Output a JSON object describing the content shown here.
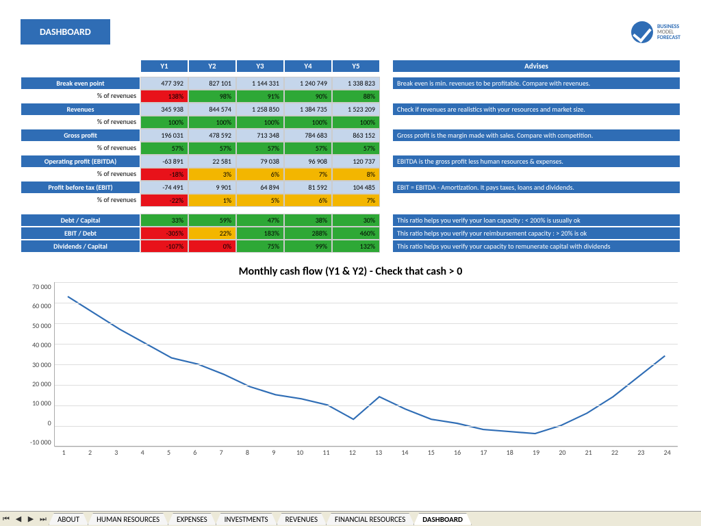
{
  "title": "DASHBOARD",
  "logo": {
    "l1": "BUSINESS",
    "l2": "MODEL",
    "l3": "FORECAST"
  },
  "years": [
    "Y1",
    "Y2",
    "Y3",
    "Y4",
    "Y5"
  ],
  "advises_header": "Advises",
  "rows": [
    {
      "label": "Break even point",
      "vals": [
        "477 392",
        "827 101",
        "1 144 331",
        "1 240 749",
        "1 338 823"
      ],
      "advice": "Break even is min. revenues to be profitable. Compare with revenues."
    },
    {
      "sub": "% of revenues",
      "pct": [
        {
          "v": "138%",
          "c": "red"
        },
        {
          "v": "98%",
          "c": "green"
        },
        {
          "v": "91%",
          "c": "green"
        },
        {
          "v": "90%",
          "c": "green"
        },
        {
          "v": "88%",
          "c": "green"
        }
      ]
    },
    {
      "label": "Revenues",
      "vals": [
        "345 938",
        "844 574",
        "1 258 850",
        "1 384 735",
        "1 523 209"
      ],
      "advice": "Check if revenues are realistics with your resources and market size."
    },
    {
      "sub": "% of revenues",
      "pct": [
        {
          "v": "100%",
          "c": "green"
        },
        {
          "v": "100%",
          "c": "green"
        },
        {
          "v": "100%",
          "c": "green"
        },
        {
          "v": "100%",
          "c": "green"
        },
        {
          "v": "100%",
          "c": "green"
        }
      ]
    },
    {
      "label": "Gross profit",
      "vals": [
        "196 031",
        "478 592",
        "713 348",
        "784 683",
        "863 152"
      ],
      "advice": "Gross profit is the margin made with sales. Compare with competition."
    },
    {
      "sub": "% of revenues",
      "pct": [
        {
          "v": "57%",
          "c": "green"
        },
        {
          "v": "57%",
          "c": "green"
        },
        {
          "v": "57%",
          "c": "green"
        },
        {
          "v": "57%",
          "c": "green"
        },
        {
          "v": "57%",
          "c": "green"
        }
      ]
    },
    {
      "label": "Operating profit (EBITDA)",
      "vals": [
        "-63 891",
        "22 581",
        "79 038",
        "96 908",
        "120 737"
      ],
      "advice": "EBITDA is the gross profit less human resources & expenses."
    },
    {
      "sub": "% of revenues",
      "pct": [
        {
          "v": "-18%",
          "c": "red"
        },
        {
          "v": "3%",
          "c": "amber"
        },
        {
          "v": "6%",
          "c": "amber"
        },
        {
          "v": "7%",
          "c": "amber"
        },
        {
          "v": "8%",
          "c": "amber"
        }
      ]
    },
    {
      "label": "Profit before tax (EBIT)",
      "vals": [
        "-74 491",
        "9 901",
        "64 894",
        "81 592",
        "104 485"
      ],
      "advice": "EBIT = EBITDA - Amortization. It pays taxes, loans and dividends."
    },
    {
      "sub": "% of revenues",
      "pct": [
        {
          "v": "-22%",
          "c": "red"
        },
        {
          "v": "1%",
          "c": "amber"
        },
        {
          "v": "5%",
          "c": "amber"
        },
        {
          "v": "6%",
          "c": "amber"
        },
        {
          "v": "7%",
          "c": "amber"
        }
      ]
    }
  ],
  "ratio_rows": [
    {
      "label": "Debt / Capital",
      "pct": [
        {
          "v": "33%",
          "c": "green"
        },
        {
          "v": "59%",
          "c": "green"
        },
        {
          "v": "47%",
          "c": "green"
        },
        {
          "v": "38%",
          "c": "green"
        },
        {
          "v": "30%",
          "c": "green"
        }
      ],
      "advice": "This ratio helps you verify your loan capacity : < 200% is usually ok"
    },
    {
      "label": "EBIT / Debt",
      "pct": [
        {
          "v": "-305%",
          "c": "red"
        },
        {
          "v": "22%",
          "c": "amber"
        },
        {
          "v": "183%",
          "c": "green"
        },
        {
          "v": "288%",
          "c": "green"
        },
        {
          "v": "460%",
          "c": "green"
        }
      ],
      "advice": "This ratio helps you verify your reimbursement capacity : > 20% is ok"
    },
    {
      "label": "Dividends / Capital",
      "pct": [
        {
          "v": "-107%",
          "c": "red"
        },
        {
          "v": "0%",
          "c": "red"
        },
        {
          "v": "75%",
          "c": "green"
        },
        {
          "v": "99%",
          "c": "green"
        },
        {
          "v": "132%",
          "c": "green"
        }
      ],
      "advice": "This ratio helps you verify your capacity to remunerate capital with dividends"
    }
  ],
  "chart_data": {
    "type": "line",
    "title": "Monthly cash flow (Y1 & Y2) - Check that cash > 0",
    "xlabel": "",
    "ylabel": "",
    "ylim": [
      -10000,
      70000
    ],
    "yticks": [
      "70 000",
      "60 000",
      "50 000",
      "40 000",
      "30 000",
      "20 000",
      "10 000",
      "0",
      "-10 000"
    ],
    "x": [
      1,
      2,
      3,
      4,
      5,
      6,
      7,
      8,
      9,
      10,
      11,
      12,
      13,
      14,
      15,
      16,
      17,
      18,
      19,
      20,
      21,
      22,
      23,
      24
    ],
    "values": [
      63000,
      55000,
      47000,
      40000,
      33000,
      30000,
      25000,
      19000,
      15000,
      13000,
      10000,
      3000,
      14000,
      8000,
      3000,
      1000,
      -2000,
      -3000,
      -4000,
      0,
      6000,
      14000,
      24000,
      34000
    ]
  },
  "tabs": [
    "ABOUT",
    "HUMAN RESOURCES",
    "EXPENSES",
    "INVESTMENTS",
    "REVENUES",
    "FINANCIAL RESOURCES",
    "DASHBOARD"
  ],
  "active_tab": "DASHBOARD"
}
